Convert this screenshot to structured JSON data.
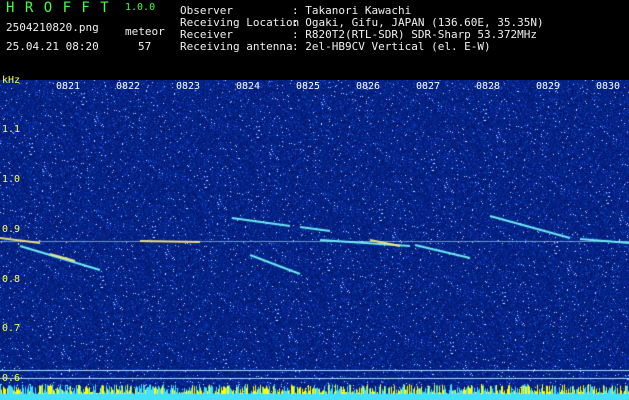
{
  "app": {
    "name": "H R O F F T",
    "version": "1.0.0"
  },
  "file": {
    "name": "2504210820.png",
    "datetime": "25.04.21 08:20"
  },
  "meteor": {
    "label": "meteor",
    "count": "57"
  },
  "info": {
    "observer_label": "Observer",
    "observer_value": ": Takanori Kawachi",
    "location_label": "Receiving Location",
    "location_value": ": Ogaki, Gifu, JAPAN (136.60E, 35.35N)",
    "receiver_label": "Receiver",
    "receiver_value": ": R820T2(RTL-SDR) SDR-Sharp 53.372MHz",
    "antenna_label": "Receiving antenna",
    "antenna_value": ": 2el-HB9CV Vertical (el. E-W)"
  },
  "axis": {
    "unit": "kHz",
    "freq_ticks": [
      "1.1",
      "1.0",
      "0.9",
      "0.8",
      "0.7",
      "0.6"
    ],
    "time_ticks": [
      "0821",
      "0822",
      "0823",
      "0824",
      "0825",
      "0826",
      "0827",
      "0828",
      "0829",
      "0830"
    ]
  },
  "colors": {
    "background": "#000000",
    "header_text": "#f0f0f0",
    "title_green": "#40ff40",
    "info_yellow": "#ffff40",
    "noise_blue": "#0a1a8a",
    "signal_cyan": "#40e0ff",
    "baseline_yellow": "#ffff00"
  }
}
